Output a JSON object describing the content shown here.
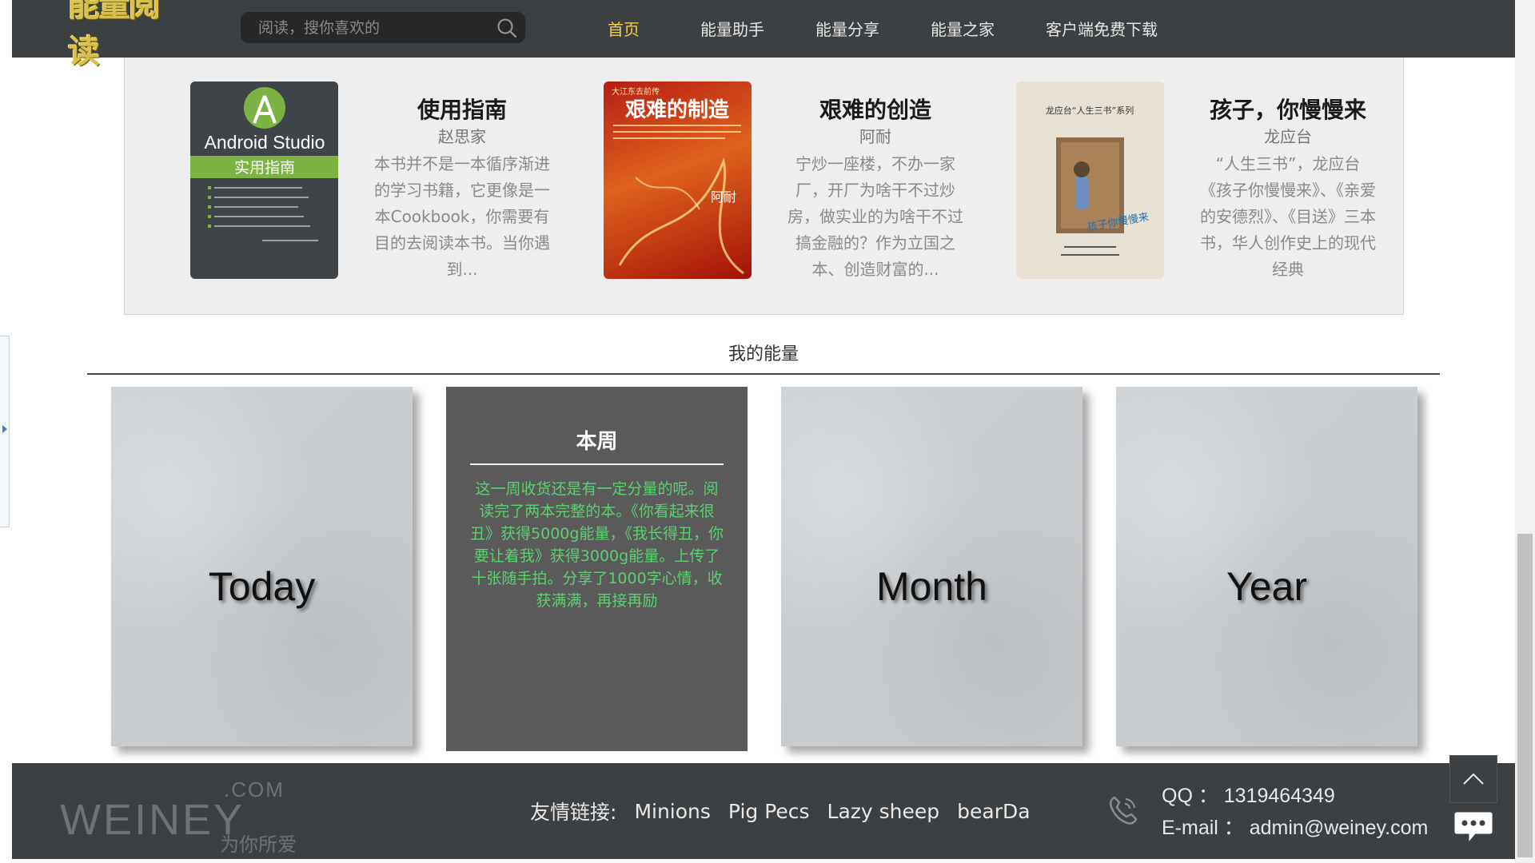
{
  "header": {
    "logo_text": "能量阅读",
    "search_placeholder": "阅读，搜你喜欢的",
    "nav": [
      {
        "label": "首页",
        "active": true
      },
      {
        "label": "能量助手",
        "active": false
      },
      {
        "label": "能量分享",
        "active": false
      },
      {
        "label": "能量之家",
        "active": false
      },
      {
        "label": "客户端免费下载",
        "active": false
      }
    ]
  },
  "books": [
    {
      "title": "使用指南",
      "author": "赵思家",
      "desc": "本书并不是一本循序渐进的学习书籍，它更像是一本Cookbook，你需要有目的去阅读本书。当你遇到...",
      "cover": {
        "line1": "Android Studio",
        "line2": "实用指南"
      }
    },
    {
      "title": "艰难的创造",
      "author": "阿耐",
      "desc": "宁炒一座楼，不办一家厂，开厂为啥干不过炒房，做实业的为啥干不过搞金融的？作为立国之本、创造财富的...",
      "cover": {
        "line0": "大江东去前传",
        "line1": "艰难的制造",
        "line2": "阿耐"
      }
    },
    {
      "title": "孩子，你慢慢来",
      "author": "龙应台",
      "desc": "“人生三书”，龙应台《孩子你慢慢来》、《亲爱的安德烈》、《目送》三本书，华人创作史上的现代经典",
      "cover": {
        "line1": "龙应台“人生三书”系列",
        "line2": "孩子你慢慢来"
      }
    }
  ],
  "energy": {
    "title": "我的能量",
    "cards": {
      "today": "Today",
      "month": "Month",
      "year": "Year"
    },
    "week": {
      "title": "本周",
      "text": "这一周收货还是有一定分量的呢。阅读完了两本完整的本。《你看起来很丑》获得5000g能量，《我长得丑，你要让着我》获得3000g能量。上传了十张随手拍。分享了1000字心情，收获满满，再接再励"
    }
  },
  "footer": {
    "brand": "WEINEY",
    "brand_suffix": ".COM",
    "slogan": "为你所爱",
    "links_label": "友情链接:",
    "links": [
      "Minions",
      "Pig Pecs",
      "Lazy sheep",
      "bearDa"
    ],
    "qq": "QQ ： 1319464349",
    "email": "E-mail ： admin@weiney.com"
  },
  "colors": {
    "header_bg": "#3d4043",
    "nav_active": "#f0d24a",
    "week_text": "#5fcf74",
    "panel_bg": "#eeeeee"
  }
}
